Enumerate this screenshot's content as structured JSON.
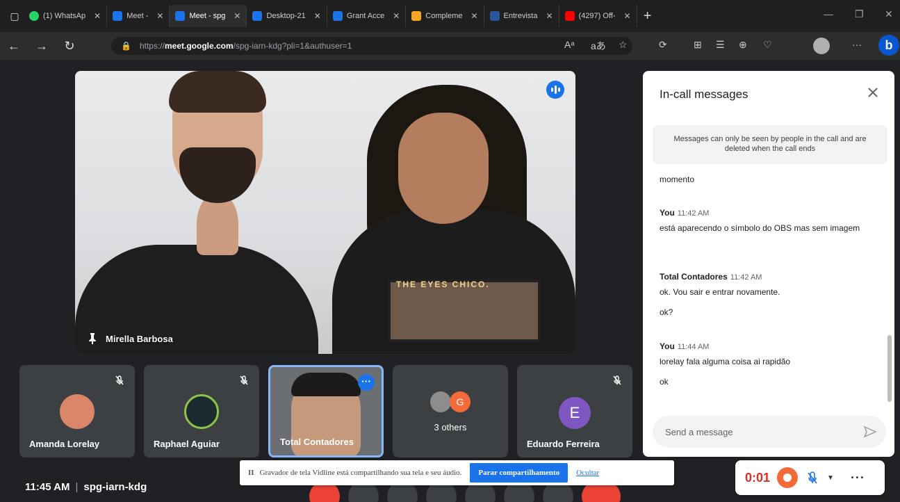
{
  "browser": {
    "tabs": [
      {
        "label": "(1) WhatsAp",
        "color": "#25d366",
        "active": false
      },
      {
        "label": "Meet - ",
        "color": "#1a73e8",
        "active": false
      },
      {
        "label": "Meet - spg",
        "color": "#1a73e8",
        "active": true
      },
      {
        "label": "Desktop-21",
        "color": "#1a73e8",
        "active": false
      },
      {
        "label": "Grant Acce",
        "color": "#1a73e8",
        "active": false
      },
      {
        "label": "Compleme",
        "color": "#f5a623",
        "active": false
      },
      {
        "label": "Entrevista",
        "color": "#2b579a",
        "active": false
      },
      {
        "label": "(4297) Off-",
        "color": "#ff0000",
        "active": false
      }
    ],
    "url_prefix": "https://",
    "url_host": "meet.google.com",
    "url_path": "/spg-iarn-kdg?pli=1&authuser=1",
    "read_aloud": "Aᵃ",
    "translate": "aあ"
  },
  "main_video": {
    "participant_name": "Mirella Barbosa",
    "shirt_text": "THE EYES CHICO."
  },
  "tiles": [
    {
      "name": "Amanda Lorelay",
      "muted": true,
      "avatar_color": "#d9866a"
    },
    {
      "name": "Raphael Aguiar",
      "muted": true,
      "avatar_color": "#1c2b2e"
    },
    {
      "name": "Total Contadores",
      "muted": false,
      "selected": true
    },
    {
      "name": "3 others",
      "others_initial": "G",
      "others_color": "#f26b38"
    },
    {
      "name": "Eduardo Ferreira",
      "muted": true,
      "initial": "E"
    }
  ],
  "chat": {
    "title": "In-call messages",
    "notice": "Messages can only be seen by people in the call and are deleted when the call ends",
    "messages": [
      {
        "sender": "",
        "time": "",
        "lines": [
          "momento"
        ]
      },
      {
        "sender": "You",
        "time": "11:42 AM",
        "lines": [
          "está aparecendo o símbolo do OBS mas sem imagem"
        ]
      },
      {
        "sender": "Total Contadores",
        "time": "11:42 AM",
        "lines": [
          "ok. Vou sair e entrar novamente.",
          "ok?"
        ]
      },
      {
        "sender": "You",
        "time": "11:44 AM",
        "lines": [
          "lorelay fala alguma coisa ai rapidão",
          "ok"
        ]
      }
    ],
    "input_placeholder": "Send a message"
  },
  "footer": {
    "time": "11:45 AM",
    "meeting_code": "spg-iarn-kdg"
  },
  "share_bar": {
    "pause_symbol": "II",
    "message": "Gravador de tela Vidline está compartilhando sua tela e seu áudio.",
    "stop_label": "Parar compartilhamento",
    "hide_label": "Ocultar"
  },
  "recorder": {
    "elapsed": "0:01",
    "more": "···"
  }
}
